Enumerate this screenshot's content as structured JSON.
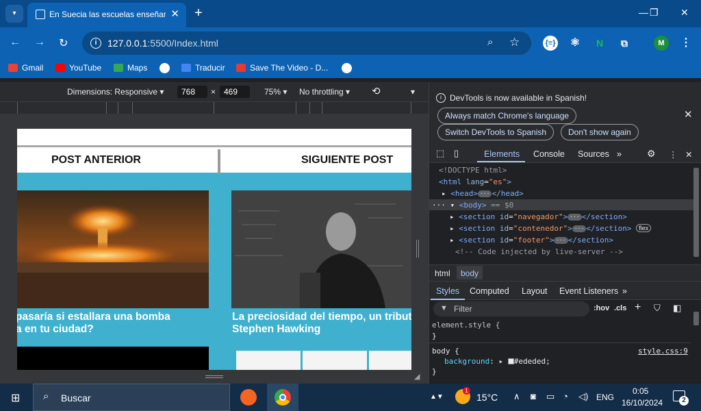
{
  "tab": {
    "title": "En Suecia las escuelas enseñara",
    "close": "✕"
  },
  "window": {
    "minimize": "—",
    "maximize": "❐",
    "close": "✕"
  },
  "address": {
    "url_host": "127.0.0.1",
    "url_rest": ":5500/Index.html"
  },
  "bookmarks": [
    {
      "label": "Gmail",
      "icon": "gmail-icon",
      "color": "#ea4335"
    },
    {
      "label": "YouTube",
      "icon": "youtube-icon",
      "color": "#ff0000"
    },
    {
      "label": "Maps",
      "icon": "maps-icon",
      "color": "#34a853"
    },
    {
      "label": "Traducir",
      "icon": "translate-icon",
      "color": "#4285f4"
    },
    {
      "label": "Save The Video - D...",
      "icon": "savethevideo-icon",
      "color": "#e53935"
    }
  ],
  "device_toolbar": {
    "dimensions": "Dimensions: Responsive",
    "width": "768",
    "times": "×",
    "height": "469",
    "zoom": "75%",
    "throttle": "No throttling"
  },
  "page": {
    "prev": "POST ANTERIOR",
    "next": "SIGUIENTE POST",
    "post1_line1": "pasaría si estallara una bomba",
    "post1_line2": "a en tu ciudad?",
    "post2_line1": "La preciosidad del tiempo, un tribut",
    "post2_line2": "Stephen Hawking"
  },
  "devtools": {
    "banner": "DevTools is now available in Spanish!",
    "btn_match": "Always match Chrome's language",
    "btn_switch": "Switch DevTools to Spanish",
    "btn_dont": "Don't show again",
    "tabs": [
      "Elements",
      "Console",
      "Sources"
    ],
    "dom": {
      "doctype": "<!DOCTYPE html>",
      "html_open": "<html",
      "html_attr": "lang",
      "html_val": "\"es\"",
      "head": "<head>",
      "head_close": "</head>",
      "body": "<body>",
      "body_eq": "== $0",
      "sec1": "\"navegador\"",
      "sec2": "\"contenedor\"",
      "sec3": "\"footer\"",
      "flex": "flex",
      "comment": "<!-- Code injected by live-server -->"
    },
    "breadcrumbs": [
      "html",
      "body"
    ],
    "style_tabs": [
      "Styles",
      "Computed",
      "Layout",
      "Event Listeners"
    ],
    "filter_placeholder": "Filter",
    "hov": ":hov",
    "cls": ".cls",
    "element_style": "element.style {",
    "close_brace": "}",
    "body_sel": "body {",
    "source": "style.css:9",
    "prop": "background",
    "value": "#ededed;"
  },
  "taskbar": {
    "search": "Buscar",
    "temp": "15°C",
    "lang": "ENG",
    "time": "0:05",
    "date": "16/10/2024",
    "notif_count": "2",
    "weather_badge": "1"
  }
}
